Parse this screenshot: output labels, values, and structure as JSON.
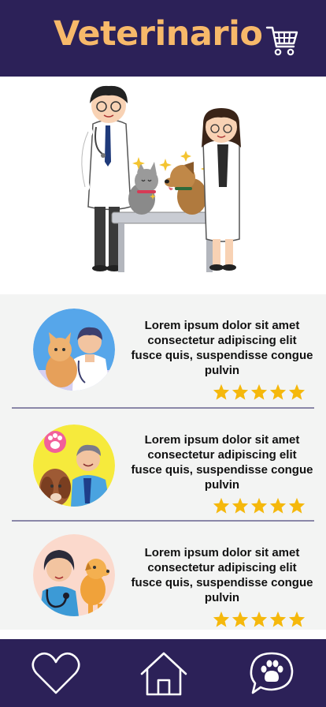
{
  "header": {
    "title": "Veterinario",
    "cart_icon": "shopping-cart-icon"
  },
  "hero": {
    "image": "veterinarians-with-cat-and-dog-illustration"
  },
  "cards": [
    {
      "text": "Lorem ipsum dolor sit amet consectetur adipiscing elit fusce quis, suspendisse congue pulvin",
      "rating": 5,
      "avatar": "vet-with-cat-avatar"
    },
    {
      "text": "Lorem ipsum dolor sit amet consectetur adipiscing elit fusce quis, suspendisse congue pulvin",
      "rating": 5,
      "avatar": "vet-with-dog-avatar"
    },
    {
      "text": "Lorem ipsum dolor sit amet consectetur adipiscing elit fusce quis, suspendisse congue pulvin",
      "rating": 5,
      "avatar": "vet-woman-with-dog-avatar"
    }
  ],
  "nav": {
    "items": [
      "heart-icon",
      "home-icon",
      "paw-chat-icon"
    ]
  },
  "colors": {
    "primary": "#2c2158",
    "accent": "#f7b96a",
    "star": "#f5b80c",
    "list_bg": "#f3f4f3"
  }
}
